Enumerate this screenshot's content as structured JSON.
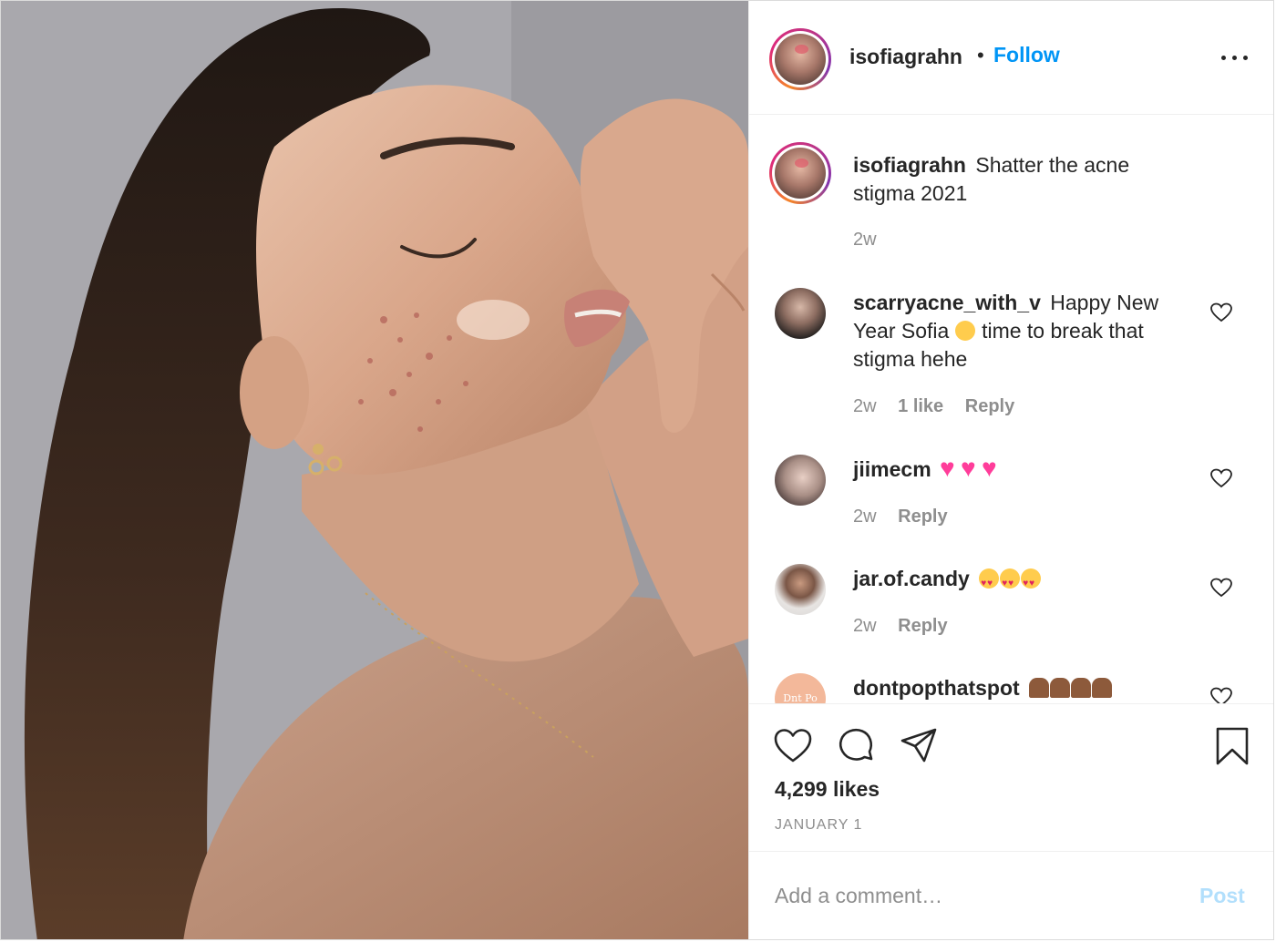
{
  "post": {
    "username": "isofiagrahn",
    "separator": "•",
    "follow_label": "Follow",
    "more_icon": "more-options-icon",
    "photo_description_icon": "post-photo"
  },
  "caption": {
    "username": "isofiagrahn",
    "text": "Shatter the acne stigma 2021",
    "time": "2w"
  },
  "comments": [
    {
      "username": "scarryacne_with_v",
      "text_before": "Happy New Year Sofia",
      "emoji": "kissing-face-emoji",
      "text_after": "time to break that stigma hehe",
      "time": "2w",
      "likes": "1 like",
      "reply": "Reply"
    },
    {
      "username": "jiimecm",
      "emoji": "sparkling-heart-emoji",
      "time": "2w",
      "reply": "Reply"
    },
    {
      "username": "jar.of.candy",
      "emoji": "heart-eyes-emoji",
      "time": "2w",
      "reply": "Reply"
    },
    {
      "username": "dontpopthatspot",
      "emoji": "praying-hands-emoji"
    }
  ],
  "avatar_d_text": "Dnt Po",
  "actions": {
    "like_icon": "heart-icon",
    "comment_icon": "comment-icon",
    "share_icon": "share-icon",
    "save_icon": "bookmark-icon"
  },
  "likes": "4,299 likes",
  "date": "JANUARY 1",
  "add_comment": {
    "placeholder": "Add a comment…",
    "post_label": "Post"
  },
  "colors": {
    "link": "#0095f6",
    "post_disabled": "#b2dffc",
    "text": "#262626",
    "muted": "#8e8e8e"
  }
}
